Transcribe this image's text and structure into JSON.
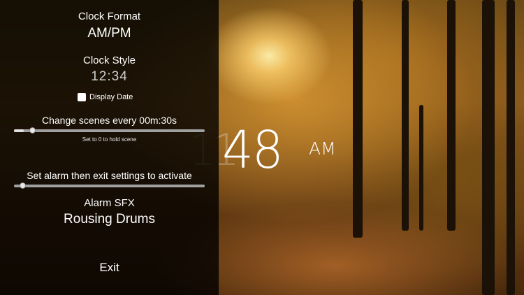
{
  "settings": {
    "clock_format_label": "Clock Format",
    "clock_format_value": "AM/PM",
    "clock_style_label": "Clock Style",
    "clock_style_preview": "12:34",
    "display_date_label": "Display Date",
    "display_date_checked": true,
    "scene_interval_label": "Change scenes every 00m:30s",
    "scene_interval_slider_fraction": 0.05,
    "scene_hint": "Set to 0 to hold scene",
    "alarm_label": "Set alarm then exit settings to activate",
    "alarm_slider_fraction": 0.0,
    "alarm_sfx_label": "Alarm SFX",
    "alarm_sfx_value": "Rousing Drums",
    "exit_label": "Exit"
  },
  "clock": {
    "hour": "11",
    "minutes": "48",
    "ampm": "AM"
  },
  "colors": {
    "panel_overlay": "#000000cc",
    "text": "#ffffff",
    "slider_track": "#a0a0a0"
  }
}
